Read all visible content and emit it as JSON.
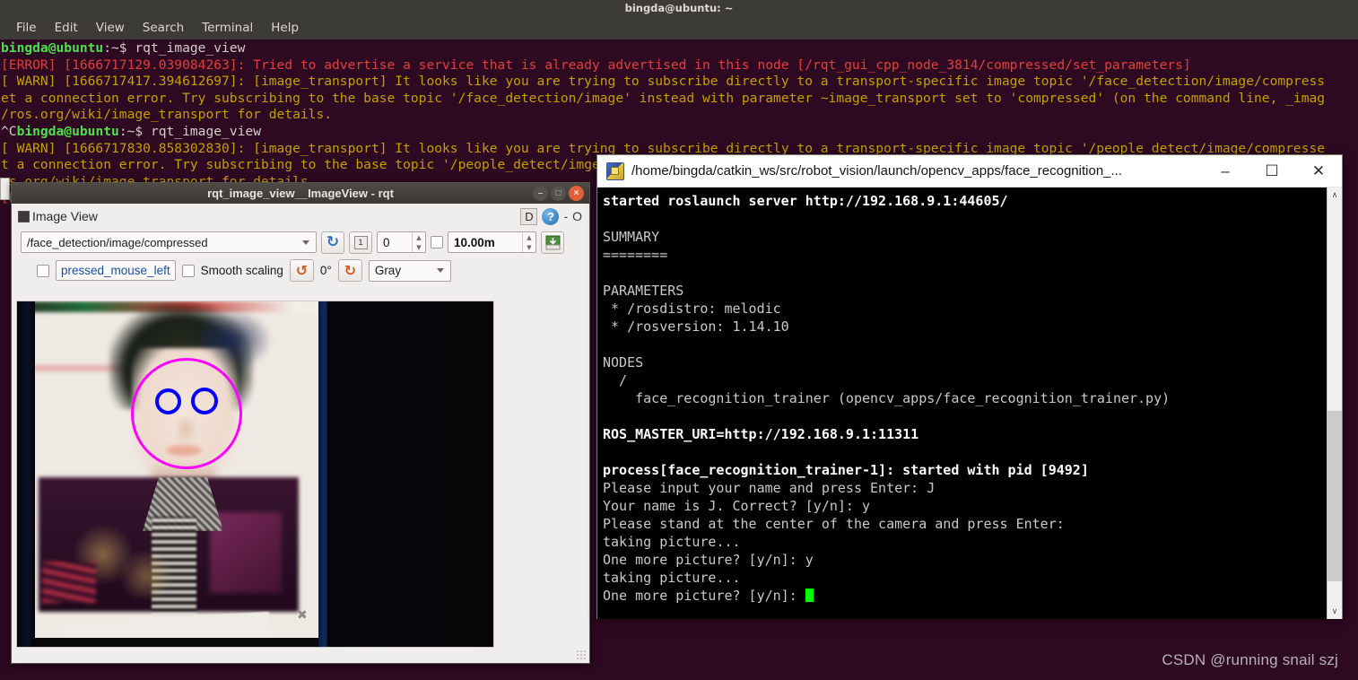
{
  "terminal": {
    "window_title": "bingda@ubuntu: ~",
    "menu": [
      "File",
      "Edit",
      "View",
      "Search",
      "Terminal",
      "Help"
    ],
    "lines": [
      {
        "segments": [
          {
            "text": "bingda@ubuntu",
            "color": "green"
          },
          {
            "text": ":~$ ",
            "color": "white"
          },
          {
            "text": "rqt_image_view",
            "color": "white"
          }
        ]
      },
      {
        "segments": [
          {
            "text": "[ERROR] [1666717129.039084263]: Tried to advertise a service that is already advertised in this node [/rqt_gui_cpp_node_3814/compressed/set_parameters]",
            "color": "red"
          }
        ]
      },
      {
        "segments": [
          {
            "text": "[ WARN] [1666717417.394612697]: [image_transport] It looks like you are trying to subscribe directly to a transport-specific image topic '/face_detection/image/compress",
            "color": "yellow"
          }
        ]
      },
      {
        "segments": [
          {
            "text": "et a connection error. Try subscribing to the base topic '/face_detection/image' instead with parameter ~image_transport set to 'compressed' (on the command line, _imag",
            "color": "yellow"
          }
        ]
      },
      {
        "segments": [
          {
            "text": "/ros.org/wiki/image_transport for details.",
            "color": "yellow"
          }
        ]
      },
      {
        "segments": [
          {
            "text": "^C",
            "color": "white"
          },
          {
            "text": "bingda@ubuntu",
            "color": "green"
          },
          {
            "text": ":~$ ",
            "color": "white"
          },
          {
            "text": "rqt_image_view",
            "color": "white"
          }
        ]
      },
      {
        "segments": [
          {
            "text": "[ WARN] [1666717830.858302830]: [image_transport] It looks like you are trying to subscribe directly to a transport-specific image topic '/people_detect/image/compresse",
            "color": "yellow"
          }
        ]
      },
      {
        "segments": [
          {
            "text": "t a connection error. Try subscribing to the base topic '/people_detect/im",
            "color": "yellow"
          },
          {
            "text": "ge_",
            "color": "yellow"
          }
        ]
      },
      {
        "segments": [
          {
            "text": "os.org/wiki/image_transport for details.",
            "color": "yellow"
          }
        ]
      },
      {
        "segments": [
          {
            "text": "[E",
            "color": "red"
          }
        ]
      }
    ]
  },
  "watermark": "CSDN @running snail szj",
  "rqt": {
    "window_title": "rqt_image_view__ImageView - rqt",
    "window_buttons": {
      "minimize": "–",
      "maximize": "□",
      "close": "×"
    },
    "plugin_title": "Image View",
    "dock_label": "D",
    "help_label": "?",
    "dash_label": "-",
    "float_label": "O",
    "topic": "/face_detection/image/compressed",
    "refresh_tooltip_glyph": "↻",
    "num_chip": "1",
    "index_value": "0",
    "max_range_value": "10.00m",
    "publish_field": "pressed_mouse_left",
    "smooth_scaling_label": "Smooth scaling",
    "rotate_left_glyph": "↺",
    "rotate_degrees": "0°",
    "rotate_right_glyph": "↻",
    "colormap": "Gray",
    "overlays": {
      "face_circle_color": "#ff00ff",
      "eye_circle_color": "#0000ff"
    }
  },
  "roslaunch": {
    "title": "/home/bingda/catkin_ws/src/robot_vision/launch/opencv_apps/face_recognition_...",
    "buttons": {
      "minimize": "–",
      "maximize": "☐",
      "close": "✕"
    },
    "lines": [
      {
        "text": "started roslaunch server http://192.168.9.1:44605/",
        "bold": true
      },
      {
        "text": "",
        "bold": false
      },
      {
        "text": "SUMMARY",
        "bold": false
      },
      {
        "text": "========",
        "bold": false
      },
      {
        "text": "",
        "bold": false
      },
      {
        "text": "PARAMETERS",
        "bold": false
      },
      {
        "text": " * /rosdistro: melodic",
        "bold": false
      },
      {
        "text": " * /rosversion: 1.14.10",
        "bold": false
      },
      {
        "text": "",
        "bold": false
      },
      {
        "text": "NODES",
        "bold": false
      },
      {
        "text": "  /",
        "bold": false
      },
      {
        "text": "    face_recognition_trainer (opencv_apps/face_recognition_trainer.py)",
        "bold": false
      },
      {
        "text": "",
        "bold": false
      },
      {
        "text": "ROS_MASTER_URI=http://192.168.9.1:11311",
        "bold": true
      },
      {
        "text": "",
        "bold": false
      },
      {
        "text": "process[face_recognition_trainer-1]: started with pid [9492]",
        "bold": true
      },
      {
        "text": "Please input your name and press Enter: J",
        "bold": false
      },
      {
        "text": "Your name is J. Correct? [y/n]: y",
        "bold": false
      },
      {
        "text": "Please stand at the center of the camera and press Enter:",
        "bold": false
      },
      {
        "text": "taking picture...",
        "bold": false
      },
      {
        "text": "One more picture? [y/n]: y",
        "bold": false
      },
      {
        "text": "taking picture...",
        "bold": false
      }
    ],
    "prompt_line": "One more picture? [y/n]: ",
    "scroll_up_glyph": "∧",
    "scroll_down_glyph": "∨"
  }
}
